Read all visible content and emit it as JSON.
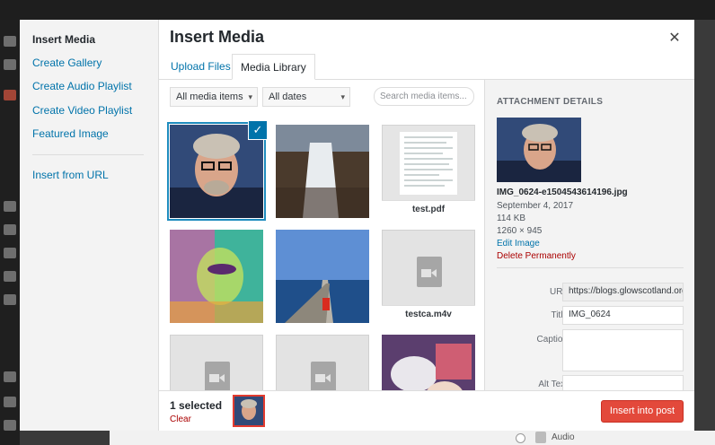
{
  "sidebar_menu": {
    "items": [
      {
        "label": "Insert Media",
        "active": true
      },
      {
        "label": "Create Gallery"
      },
      {
        "label": "Create Audio Playlist"
      },
      {
        "label": "Create Video Playlist"
      },
      {
        "label": "Featured Image"
      },
      {
        "label": "Insert from URL"
      }
    ]
  },
  "frame": {
    "title": "Insert Media",
    "close_icon": "close-icon"
  },
  "tabs": [
    {
      "label": "Upload Files"
    },
    {
      "label": "Media Library",
      "active": true
    }
  ],
  "toolbar": {
    "type_filter": "All media items",
    "date_filter": "All dates",
    "search_placeholder": "Search media items..."
  },
  "attachments": [
    {
      "kind": "image",
      "subject": "man-portrait",
      "selected": true
    },
    {
      "kind": "image",
      "subject": "waterfall"
    },
    {
      "kind": "document",
      "filename": "test.pdf"
    },
    {
      "kind": "image",
      "subject": "colorful-portrait"
    },
    {
      "kind": "image",
      "subject": "lighthouse-pier"
    },
    {
      "kind": "video",
      "filename": "testca.m4v"
    },
    {
      "kind": "video"
    },
    {
      "kind": "video"
    },
    {
      "kind": "image",
      "subject": "kids-crafts"
    }
  ],
  "details": {
    "heading": "Attachment Details",
    "filename": "IMG_0624-e1504543614196.jpg",
    "date": "September 4, 2017",
    "size": "114 KB",
    "dimensions": "1260 × 945",
    "edit_link": "Edit Image",
    "delete_link": "Delete Permanently",
    "fields": {
      "url_label": "URL",
      "url_value": "https://blogs.glowscotland.org.uk/",
      "title_label": "Title",
      "title_value": "IMG_0624",
      "caption_label": "Caption",
      "alt_label": "Alt Text"
    }
  },
  "footer": {
    "selected_count": "1 selected",
    "clear_label": "Clear",
    "insert_button": "Insert into post"
  },
  "background": {
    "audio_label": "Audio"
  },
  "colors": {
    "accent": "#0073aa",
    "danger": "#a00000",
    "primary_button": "#e3493b"
  }
}
